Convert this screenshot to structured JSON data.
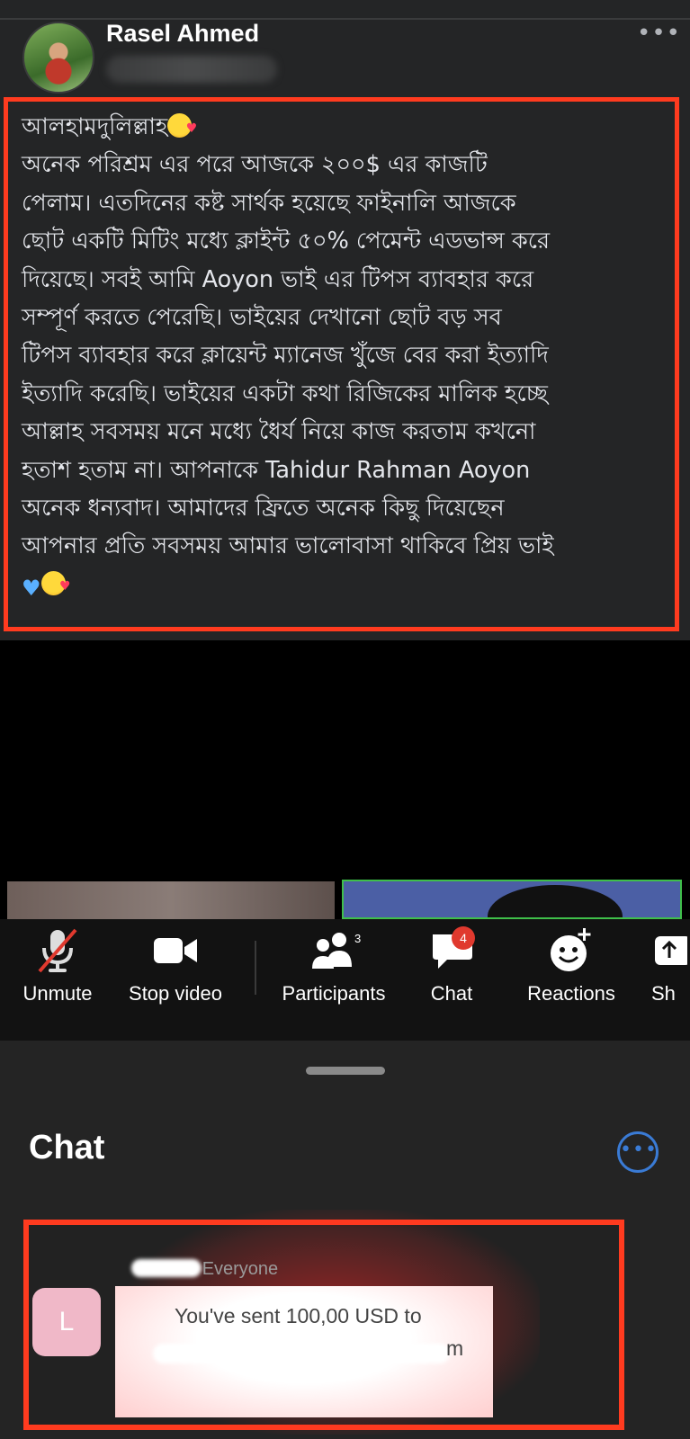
{
  "post": {
    "author": "Rasel Ahmed",
    "more": "•••",
    "lines": [
      "আলহামদুলিল্লাহ",
      "অনেক পরিশ্রম এর পরে আজকে ২০০$ এর কাজটি",
      "পেলাম। এতদিনের কষ্ট সার্থক হয়েছে ফাইনালি আজকে",
      "ছোট একটি মিটিং মধ্যে ক্লাইন্ট ৫০% পেমেন্ট এডভান্স করে",
      "দিয়েছে। সবই আমি Aoyon ভাই এর টিপস ব্যাবহার করে",
      "সম্পূর্ণ করতে পেরেছি। ভাইয়ের দেখানো ছোট বড় সব",
      "টিপস ব্যাবহার করে ক্লায়েন্ট ম্যানেজ খুঁজে বের করা ইত্যাদি",
      "ইত্যাদি করেছি। ভাইয়ের একটা কথা রিজিকের মালিক হচ্ছে",
      "আল্লাহ সবসময় মনে মধ্যে ধৈর্য নিয়ে কাজ করতাম কখনো",
      "হতাশ হতাম না। আপনাকে Tahidur Rahman Aoyon",
      "অনেক ধন্যবাদ। আমাদের ফ্রিতে অনেক কিছু দিয়েছেন",
      "আপনার প্রতি সবসময় আমার ভালোবাসা থাকিবে প্রিয় ভাই"
    ],
    "emojis": [
      "smiling-face-with-hearts",
      "blue-heart"
    ],
    "highlight_color": "#ff3b1f"
  },
  "toolbar": {
    "unmute": "Unmute",
    "stop_video": "Stop video",
    "participants": "Participants",
    "participants_count": "3",
    "chat": "Chat",
    "chat_badge": "4",
    "reactions": "Reactions",
    "share": "Sh"
  },
  "chat": {
    "title": "Chat",
    "recipient": "Everyone",
    "recipient_prefix": "o",
    "avatar_initial": "L",
    "message_line1": "You've sent 100,00 USD to",
    "message_line2_tail": "m"
  }
}
